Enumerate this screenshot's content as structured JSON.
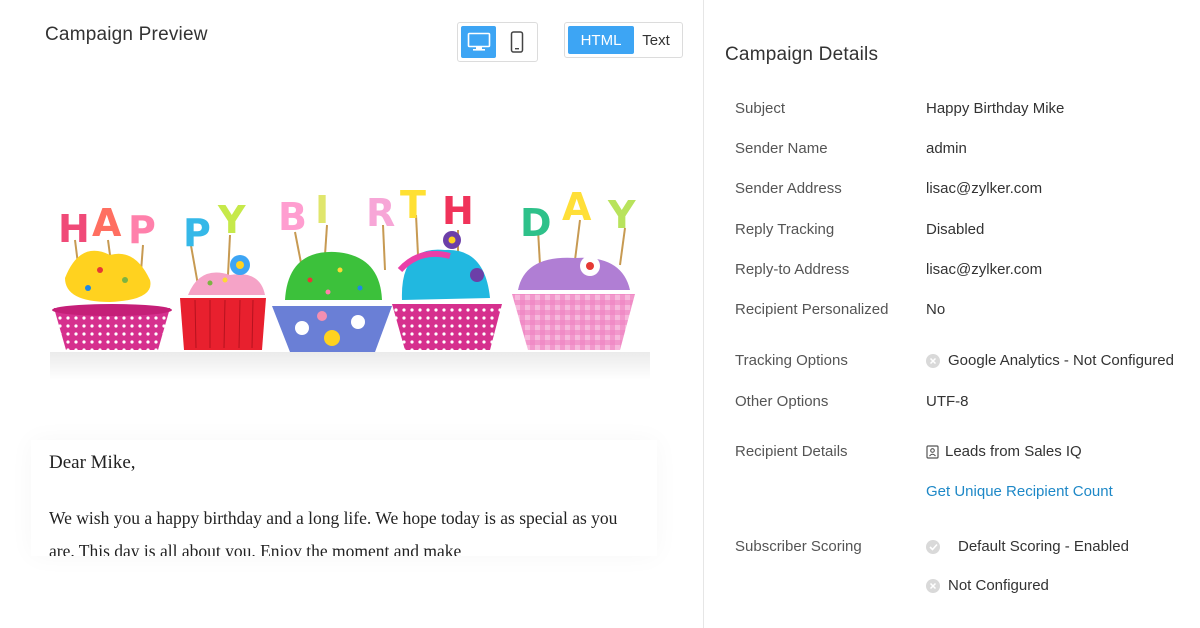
{
  "preview": {
    "title": "Campaign Preview",
    "device_toggle": {
      "desktop": "desktop-icon",
      "mobile": "mobile-icon",
      "selected": "desktop"
    },
    "format_toggle": {
      "html_label": "HTML",
      "text_label": "Text",
      "selected": "HTML"
    },
    "banner": {
      "letters": [
        "H",
        "A",
        "P",
        "P",
        "Y",
        "B",
        "I",
        "R",
        "T",
        "H",
        "D",
        "A",
        "Y"
      ]
    },
    "email": {
      "greeting": "Dear Mike,",
      "message": "We wish you a happy birthday and a long life. We hope today is as special as you are. This day is all about you. Enjoy the moment and make"
    }
  },
  "details": {
    "title": "Campaign Details",
    "subject_label": "Subject",
    "subject_value": "Happy Birthday Mike",
    "sender_name_label": "Sender Name",
    "sender_name_value": "admin",
    "sender_address_label": "Sender Address",
    "sender_address_value": "lisac@zylker.com",
    "reply_tracking_label": "Reply Tracking",
    "reply_tracking_value": "Disabled",
    "reply_to_label": "Reply-to Address",
    "reply_to_value": "lisac@zylker.com",
    "personalized_label": "Recipient Personalized",
    "personalized_value": "No",
    "tracking_label": "Tracking Options",
    "tracking_value": "Google Analytics - Not Configured",
    "other_label": "Other Options",
    "other_value": "UTF-8",
    "recipient_label": "Recipient Details",
    "recipient_value": "Leads from Sales IQ",
    "recipient_link": "Get Unique Recipient Count",
    "scoring_label": "Subscriber Scoring",
    "scoring_value_1": "Default Scoring - Enabled",
    "scoring_value_2": "Not Configured"
  },
  "colors": {
    "accent": "#3da5f4",
    "link": "#1e88c7",
    "divider": "#e6e6e6"
  }
}
